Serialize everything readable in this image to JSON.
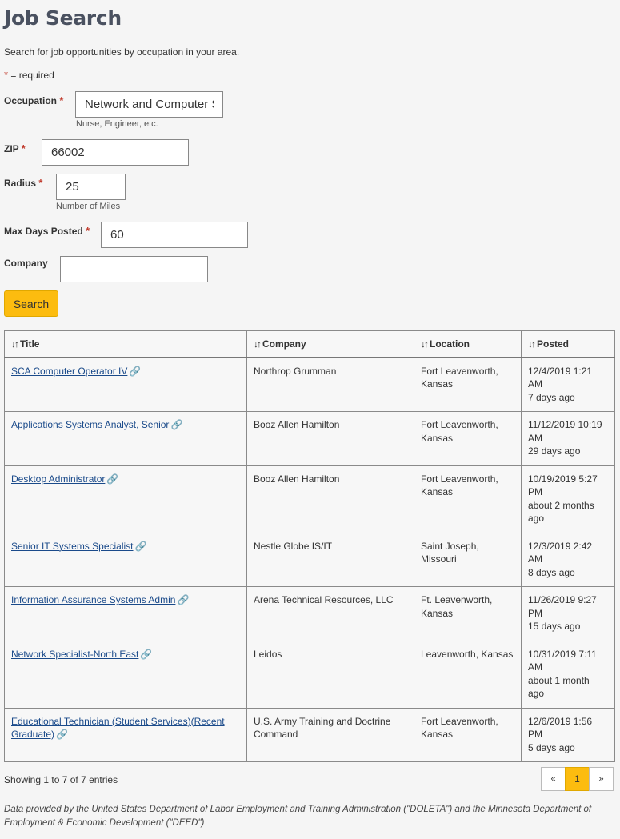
{
  "page": {
    "title": "Job Search",
    "intro": "Search for job opportunities by occupation in your area.",
    "required_star": "*",
    "required_note": " = required"
  },
  "form": {
    "occupation": {
      "label": "Occupation",
      "value": "Network and Computer Systems",
      "hint": "Nurse, Engineer, etc."
    },
    "zip": {
      "label": "ZIP",
      "value": "66002"
    },
    "radius": {
      "label": "Radius",
      "value": "25",
      "hint": "Number of Miles"
    },
    "max_days": {
      "label": "Max Days Posted",
      "value": "60"
    },
    "company": {
      "label": "Company",
      "value": ""
    },
    "search_label": "Search"
  },
  "table": {
    "sort_icon": "sort-icon",
    "columns": [
      "Title",
      "Company",
      "Location",
      "Posted"
    ],
    "rows": [
      {
        "title": "SCA Computer Operator IV",
        "company": "Northrop Grumman",
        "location": "Fort Leavenworth, Kansas",
        "posted": "12/4/2019 1:21 AM",
        "ago": "7 days ago"
      },
      {
        "title": "Applications Systems Analyst, Senior",
        "company": "Booz Allen Hamilton",
        "location": "Fort Leavenworth, Kansas",
        "posted": "11/12/2019 10:19 AM",
        "ago": "29 days ago"
      },
      {
        "title": "Desktop Administrator",
        "company": "Booz Allen Hamilton",
        "location": "Fort Leavenworth, Kansas",
        "posted": "10/19/2019 5:27 PM",
        "ago": "about 2 months ago"
      },
      {
        "title": "Senior IT Systems Specialist",
        "company": "Nestle Globe IS/IT",
        "location": "Saint Joseph, Missouri",
        "posted": "12/3/2019 2:42 AM",
        "ago": "8 days ago"
      },
      {
        "title": "Information Assurance Systems Admin",
        "company": "Arena Technical Resources, LLC",
        "location": "Ft. Leavenworth, Kansas",
        "posted": "11/26/2019 9:27 PM",
        "ago": "15 days ago"
      },
      {
        "title": "Network Specialist-North East",
        "company": "Leidos",
        "location": "Leavenworth, Kansas",
        "posted": "10/31/2019 7:11 AM",
        "ago": "about 1 month ago"
      },
      {
        "title": "Educational Technician (Student Services)(Recent Graduate)",
        "company": "U.S. Army Training and Doctrine Command",
        "location": "Fort Leavenworth, Kansas",
        "posted": "12/6/2019 1:56 PM",
        "ago": "5 days ago"
      }
    ]
  },
  "pagination": {
    "showing": "Showing 1 to 7 of 7 entries",
    "prev": "«",
    "current": "1",
    "next": "»"
  },
  "footer": "Data provided by the United States Department of Labor Employment and Training Administration (\"DOLETA\") and the Minnesota Department of Employment & Economic Development (\"DEED\")",
  "colors": {
    "accent": "#fcbc0f",
    "link": "#1a4a8a",
    "required": "#c0392b",
    "title": "#4a5160"
  }
}
